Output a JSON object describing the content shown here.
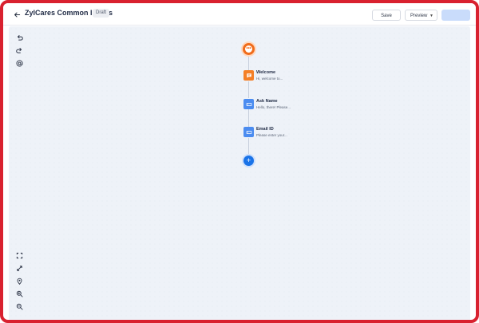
{
  "header": {
    "back_icon": "back-arrow-icon",
    "title": "ZylCares Common Issues",
    "status_badge": "Draft",
    "save_label": "Save",
    "preview_label": "Preview"
  },
  "toolbar_top": [
    {
      "name": "undo",
      "icon": "undo-icon"
    },
    {
      "name": "redo",
      "icon": "redo-icon"
    },
    {
      "name": "mention",
      "icon": "at-icon"
    }
  ],
  "toolbar_bottom": [
    {
      "name": "fit-screen",
      "icon": "fit-screen-icon"
    },
    {
      "name": "expand",
      "icon": "expand-icon"
    },
    {
      "name": "locate",
      "icon": "location-pin-icon"
    },
    {
      "name": "zoom-in",
      "icon": "zoom-in-icon"
    },
    {
      "name": "zoom-out",
      "icon": "zoom-out-icon"
    }
  ],
  "flow": {
    "start_icon": "bot-start-icon",
    "nodes": [
      {
        "title": "Welcome",
        "subtitle": "Hi, welcome to...",
        "icon": "message-icon",
        "color": "#f47f26"
      },
      {
        "title": "Ask Name",
        "subtitle": "Hello, there! Please...",
        "icon": "input-icon",
        "color": "#4b8cf0"
      },
      {
        "title": "Email ID",
        "subtitle": "Please enter your...",
        "icon": "input-icon",
        "color": "#4b8cf0"
      }
    ],
    "add_icon": "plus-icon"
  },
  "colors": {
    "frame_border": "#d9212f",
    "accent": "#1a73e8",
    "start_node": "#f06c1b"
  }
}
